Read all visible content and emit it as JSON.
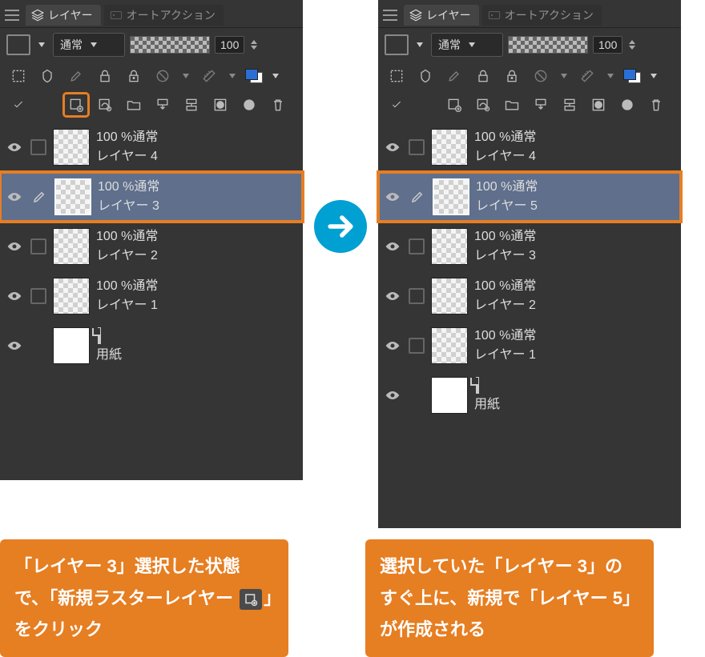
{
  "tabs": {
    "layers": "レイヤー",
    "auto_action": "オートアクション"
  },
  "toolbar": {
    "blend_mode": "通常",
    "opacity": "100"
  },
  "left_layers": [
    {
      "opacity_mode": "100 %通常",
      "name": "レイヤー 4",
      "selected": false,
      "highlight": false
    },
    {
      "opacity_mode": "100 %通常",
      "name": "レイヤー 3",
      "selected": true,
      "highlight": true
    },
    {
      "opacity_mode": "100 %通常",
      "name": "レイヤー 2",
      "selected": false,
      "highlight": false
    },
    {
      "opacity_mode": "100 %通常",
      "name": "レイヤー 1",
      "selected": false,
      "highlight": false
    }
  ],
  "right_layers": [
    {
      "opacity_mode": "100 %通常",
      "name": "レイヤー 4",
      "selected": false,
      "highlight": false
    },
    {
      "opacity_mode": "100 %通常",
      "name": "レイヤー 5",
      "selected": true,
      "highlight": true
    },
    {
      "opacity_mode": "100 %通常",
      "name": "レイヤー 3",
      "selected": false,
      "highlight": false
    },
    {
      "opacity_mode": "100 %通常",
      "name": "レイヤー 2",
      "selected": false,
      "highlight": false
    },
    {
      "opacity_mode": "100 %通常",
      "name": "レイヤー 1",
      "selected": false,
      "highlight": false
    }
  ],
  "paper_label": "用紙",
  "captions": {
    "left": "「レイヤー 3」選択した状態で、「新規ラスターレイヤー         」をクリック",
    "right": "選択していた「レイヤー 3」のすぐ上に、新規で「レイヤー 5」が作成される"
  },
  "icons": {
    "new_raster": "new-raster-layer"
  }
}
